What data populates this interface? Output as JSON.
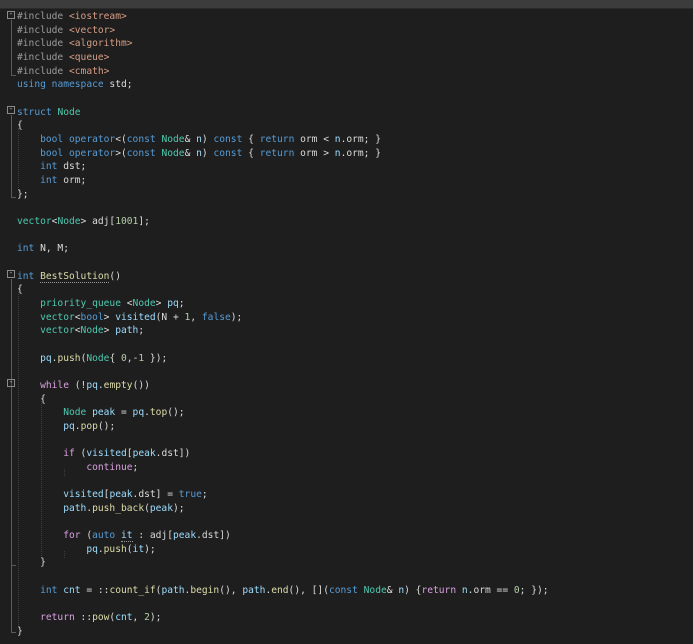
{
  "editor": {
    "language": "C++",
    "theme_colors": {
      "background": "#1e1e1e",
      "keyword": "#569cd6",
      "type": "#4ec9b0",
      "preprocessor": "#9b9b9b",
      "string": "#d69d85",
      "number": "#b5cea8",
      "function": "#dcdcaa",
      "default": "#dcdcdc"
    },
    "lines": [
      "#include <iostream>",
      "#include <vector>",
      "#include <algorithm>",
      "#include <queue>",
      "#include <cmath>",
      "using namespace std;",
      "",
      "struct Node",
      "{",
      "    bool operator<(const Node& n) const { return orm < n.orm; }",
      "    bool operator>(const Node& n) const { return orm > n.orm; }",
      "    int dst;",
      "    int orm;",
      "};",
      "",
      "vector<Node> adj[1001];",
      "",
      "int N, M;",
      "",
      "int BestSolution()",
      "{",
      "    priority_queue <Node> pq;",
      "    vector<bool> visited(N + 1, false);",
      "    vector<Node> path;",
      "",
      "    pq.push(Node{ 0,-1 });",
      "",
      "    while (!pq.empty())",
      "    {",
      "        Node peak = pq.top();",
      "        pq.pop();",
      "",
      "        if (visited[peak.dst])",
      "            continue;",
      "",
      "        visited[peak.dst] = true;",
      "        path.push_back(peak);",
      "",
      "        for (auto it : adj[peak.dst])",
      "            pq.push(it);",
      "    }",
      "",
      "    int cnt = ::count_if(path.begin(), path.end(), [](const Node& n) {return n.orm == 0; });",
      "",
      "    return ::pow(cnt, 2);",
      "}"
    ]
  }
}
